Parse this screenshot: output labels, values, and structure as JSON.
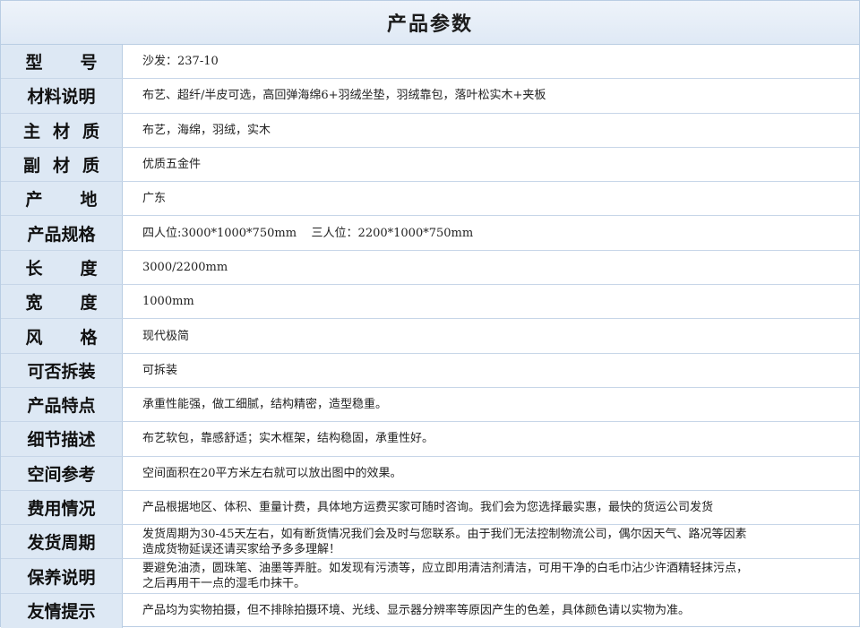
{
  "header": {
    "title": "产品参数"
  },
  "rows": [
    {
      "label": "型号",
      "value": "沙发：237-10"
    },
    {
      "label": "材料说明",
      "value": "布艺、超纤/半皮可选，高回弹海绵6+羽绒坐垫，羽绒靠包，落叶松实木+夹板"
    },
    {
      "label": "主材质",
      "value": "布艺，海绵，羽绒，实木"
    },
    {
      "label": "副材质",
      "value": "优质五金件"
    },
    {
      "label": "产地",
      "value": "广东"
    },
    {
      "label": "产品规格",
      "value": "四人位:3000*1000*750mm    三人位：2200*1000*750mm"
    },
    {
      "label": "长度",
      "value": "3000/2200mm"
    },
    {
      "label": "宽度",
      "value": "1000mm"
    },
    {
      "label": "风格",
      "value": "现代极简"
    },
    {
      "label": "可否拆装",
      "value": "可拆装"
    },
    {
      "label": "产品特点",
      "value": "承重性能强，做工细腻，结构精密，造型稳重。"
    },
    {
      "label": "细节描述",
      "value": "布艺软包，靠感舒适；实木框架，结构稳固，承重性好。"
    },
    {
      "label": "空间参考",
      "value": "空间面积在20平方米左右就可以放出图中的效果。"
    },
    {
      "label": "费用情况",
      "value": "产品根据地区、体积、重量计费，具体地方运费买家可随时咨询。我们会为您选择最实惠，最快的货运公司发货"
    },
    {
      "label": "发货周期",
      "value": "发货周期为30-45天左右，如有断货情况我们会及时与您联系。由于我们无法控制物流公司，偶尔因天气、路况等因素\n造成货物延误还请买家给予多多理解！"
    },
    {
      "label": "保养说明",
      "value": "要避免油渍，圆珠笔、油墨等弄脏。如发现有污渍等，应立即用清洁剂清洁，可用干净的白毛巾沾少许酒精轻抹污点，\n之后再用干一点的湿毛巾抹干。"
    },
    {
      "label": "友情提示",
      "value": "产品均为实物拍摄，但不排除拍摄环境、光线、显示器分辨率等原因产生的色差，具体颜色请以实物为准。"
    }
  ]
}
